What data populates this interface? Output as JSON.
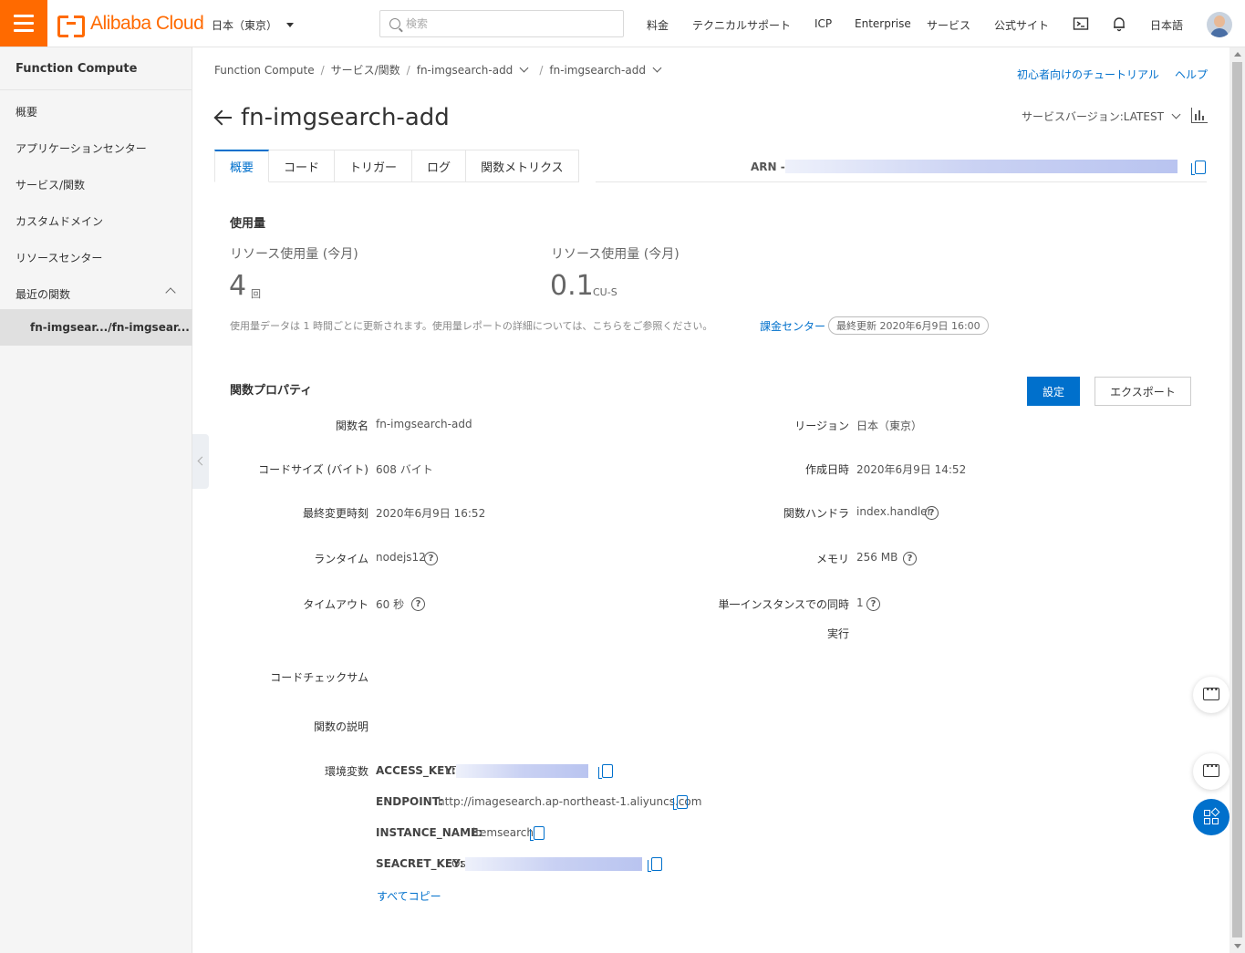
{
  "topbar": {
    "brand": "Alibaba Cloud",
    "region": "日本（東京）",
    "search_placeholder": "検索",
    "nav": [
      "料金",
      "テクニカルサポート",
      "ICP",
      "Enterprise",
      "サービス",
      "公式サイト"
    ],
    "language": "日本語"
  },
  "sidebar": {
    "title": "Function Compute",
    "items": [
      "概要",
      "アプリケーションセンター",
      "サービス/関数",
      "カスタムドメイン",
      "リソースセンター",
      "最近の関数"
    ],
    "recent_function": "fn-imgsear.../fn-imgsear..."
  },
  "breadcrumb": {
    "items": [
      "Function Compute",
      "サービス/関数",
      "fn-imgsearch-add",
      "fn-imgsearch-add"
    ]
  },
  "help_links": {
    "tutorial": "初心者向けのチュートリアル",
    "help": "ヘルプ"
  },
  "page": {
    "title": "fn-imgsearch-add",
    "service_version": "サービスバージョン:LATEST"
  },
  "tabs": [
    "概要",
    "コード",
    "トリガー",
    "ログ",
    "関数メトリクス"
  ],
  "arn_label": "ARN - a",
  "usage": {
    "title": "使用量",
    "metrics": [
      {
        "label": "リソース使用量 (今月)",
        "value": "4",
        "unit": "回"
      },
      {
        "label": "リソース使用量 (今月)",
        "value": "0.1",
        "unit": "CU-S"
      }
    ],
    "note": "使用量データは 1 時間ごとに更新されます。使用量レポートの詳細については、こちらをご参照ください。",
    "billing_link": "課金センター",
    "last_updated": "最終更新  2020年6月9日 16:00"
  },
  "properties": {
    "title": "関数プロパティ",
    "settings_button": "設定",
    "export_button": "エクスポート",
    "left": [
      {
        "label": "関数名",
        "value": "fn-imgsearch-add"
      },
      {
        "label": "コードサイズ (バイト)",
        "value": "608 バイト"
      },
      {
        "label": "最終変更時刻",
        "value": "2020年6月9日 16:52"
      },
      {
        "label": "ランタイム",
        "value": "nodejs12"
      },
      {
        "label": "タイムアウト",
        "value": "60   秒"
      }
    ],
    "right": [
      {
        "label": "リージョン",
        "value": "日本（東京）"
      },
      {
        "label": "作成日時",
        "value": "2020年6月9日 14:52"
      },
      {
        "label": "関数ハンドラ",
        "value": "index.handler"
      },
      {
        "label": "メモリ",
        "value": "256    MB"
      },
      {
        "label": "単一インスタンスでの同時",
        "label2": "実行",
        "value": "1"
      }
    ],
    "code_checksum_label": "コードチェックサム",
    "description_label": "関数の説明",
    "env_label": "環境変数",
    "env": [
      {
        "key": "ACCESS_KEY:",
        "value": "LT/"
      },
      {
        "key": "ENDPOINT:",
        "value": "http://imagesearch.ap-northeast-1.aliyuncs.com"
      },
      {
        "key": "INSTANCE_NAME:",
        "value": "itemsearch"
      },
      {
        "key": "SEACRET_KEY:",
        "value": "Os"
      }
    ],
    "copy_all": "すべてコピー"
  }
}
